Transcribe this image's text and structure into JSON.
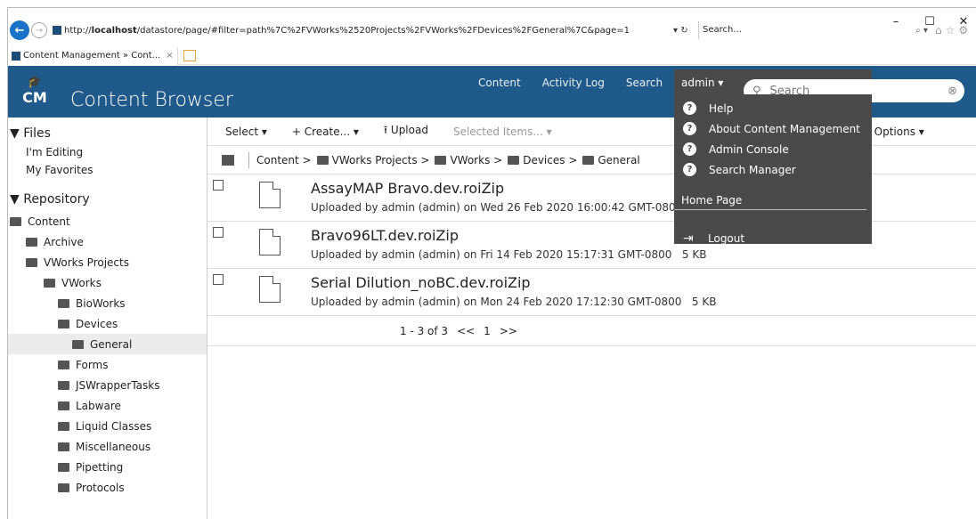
{
  "browser": {
    "url_prefix": "http://",
    "url_host": "localhost",
    "url_rest": "/datastore/page/#filter=path%7C%2FVWorks%2520Projects%2FVWorks%2FDevices%2FGeneral%7C&page=1",
    "search_placeholder": "Search...",
    "tab_title": "Content Management » Cont...",
    "win_minimize": "–",
    "win_maximize": "☐",
    "win_close": "✕"
  },
  "header": {
    "logo": "CM",
    "brand": "Content Browser",
    "nav": [
      "Content",
      "Activity Log",
      "Search"
    ],
    "user_menu": "admin ▾",
    "search_placeholder": "Search"
  },
  "user_dropdown": {
    "items": [
      "Help",
      "About Content Management",
      "Admin Console",
      "Search Manager"
    ],
    "home_page": "Home Page",
    "logout": "Logout"
  },
  "sidebar": {
    "files_header": "▼ Files",
    "files_items": [
      "I'm Editing",
      "My Favorites"
    ],
    "repo_header": "▼ Repository",
    "tree": [
      {
        "label": "Content",
        "depth": 0
      },
      {
        "label": "Archive",
        "depth": 1
      },
      {
        "label": "VWorks Projects",
        "depth": 1
      },
      {
        "label": "VWorks",
        "depth": 2
      },
      {
        "label": "BioWorks",
        "depth": 3
      },
      {
        "label": "Devices",
        "depth": 3
      },
      {
        "label": "General",
        "depth": 4,
        "selected": true
      },
      {
        "label": "Forms",
        "depth": 3
      },
      {
        "label": "JSWrapperTasks",
        "depth": 3
      },
      {
        "label": "Labware",
        "depth": 3
      },
      {
        "label": "Liquid Classes",
        "depth": 3
      },
      {
        "label": "Miscellaneous",
        "depth": 3
      },
      {
        "label": "Pipetting",
        "depth": 3
      },
      {
        "label": "Protocols",
        "depth": 3
      }
    ]
  },
  "toolbar": {
    "select": "Select ▾",
    "create": "+ Create... ▾",
    "upload": "⭱ Upload",
    "selected": "Selected Items... ▾",
    "options": "Options ▾"
  },
  "breadcrumb": [
    "Content",
    "VWorks Projects",
    "VWorks",
    "Devices",
    "General"
  ],
  "files": [
    {
      "name": "AssayMAP Bravo.dev.roiZip",
      "meta": "Uploaded by admin (admin) on Wed 26 Feb 2020 16:00:42 GMT-0800",
      "size": ""
    },
    {
      "name": "Bravo96LT.dev.roiZip",
      "meta": "Uploaded by admin (admin) on Fri 14 Feb 2020 15:17:31 GMT-0800",
      "size": "5 KB"
    },
    {
      "name": "Serial Dilution_noBC.dev.roiZip",
      "meta": "Uploaded by admin (admin) on Mon 24 Feb 2020 17:12:30 GMT-0800",
      "size": "5 KB"
    }
  ],
  "pager": {
    "range": "1 - 3 of 3",
    "prev": "<<",
    "page": "1",
    "next": ">>"
  }
}
